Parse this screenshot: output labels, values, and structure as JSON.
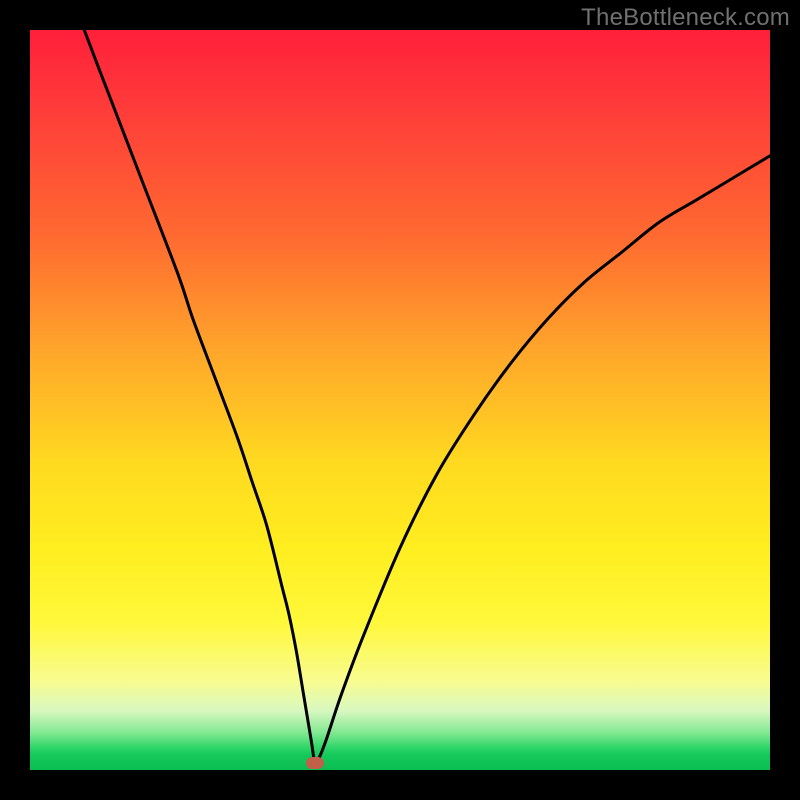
{
  "watermark": "TheBottleneck.com",
  "chart_data": {
    "type": "line",
    "title": "",
    "xlabel": "",
    "ylabel": "",
    "x_range": [
      0,
      100
    ],
    "y_range": [
      0,
      100
    ],
    "series": [
      {
        "name": "bottleneck-curve",
        "x": [
          0,
          5,
          10,
          15,
          20,
          22,
          25,
          28,
          30,
          32,
          34,
          35,
          36,
          37,
          38,
          38.5,
          39,
          40,
          42,
          45,
          50,
          55,
          60,
          65,
          70,
          75,
          80,
          85,
          90,
          95,
          100
        ],
        "y": [
          118,
          106,
          93,
          80,
          67,
          61,
          53,
          45,
          39,
          33,
          25,
          21,
          16,
          10,
          4,
          1,
          1.5,
          4,
          10,
          18,
          30,
          40,
          48,
          55,
          61,
          66,
          70,
          74,
          77,
          80,
          83
        ]
      }
    ],
    "marker": {
      "x": 38.5,
      "y": 1
    },
    "gradient_stops": [
      {
        "pct": 0,
        "color": "#ff1f3a"
      },
      {
        "pct": 10,
        "color": "#ff3a3a"
      },
      {
        "pct": 28,
        "color": "#ff6a30"
      },
      {
        "pct": 44,
        "color": "#ffa82a"
      },
      {
        "pct": 58,
        "color": "#ffd820"
      },
      {
        "pct": 70,
        "color": "#ffee20"
      },
      {
        "pct": 80,
        "color": "#fff83a"
      },
      {
        "pct": 88,
        "color": "#f8fc90"
      },
      {
        "pct": 92,
        "color": "#d8f8c0"
      },
      {
        "pct": 95,
        "color": "#80e890"
      },
      {
        "pct": 97,
        "color": "#2ed568"
      },
      {
        "pct": 98,
        "color": "#14c85a"
      },
      {
        "pct": 100,
        "color": "#0abf52"
      }
    ]
  }
}
